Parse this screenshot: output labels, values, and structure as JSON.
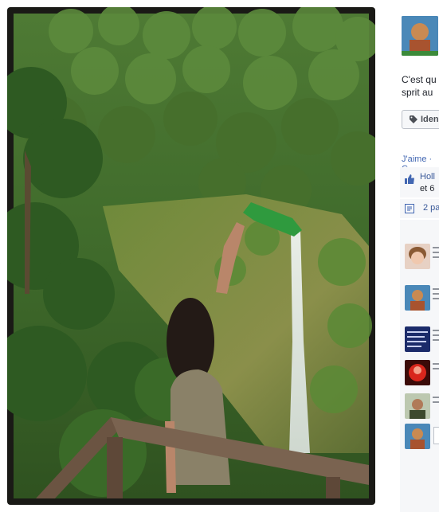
{
  "post": {
    "caption_lines": [
      "C'est qu",
      "sprit au"
    ],
    "tag_button_label": "Iden",
    "actions_text": "J'aime · C",
    "likes_line1": "Holl",
    "likes_line2": "et 6",
    "shares_text": "2 pa"
  },
  "icons": {
    "tag": "tag-icon",
    "like": "thumbs-up-icon",
    "share": "share-icon"
  },
  "colors": {
    "link": "#4267b2",
    "ufi_background": "#f6f7f9",
    "frame": "#1a1a16"
  },
  "comments": [
    {
      "avatar": "woman-portrait"
    },
    {
      "avatar": "cartoon-character"
    },
    {
      "avatar": "screenshot-thumbnail"
    },
    {
      "avatar": "red-glow"
    },
    {
      "avatar": "man-portrait"
    },
    {
      "avatar": "cartoon-character"
    }
  ]
}
